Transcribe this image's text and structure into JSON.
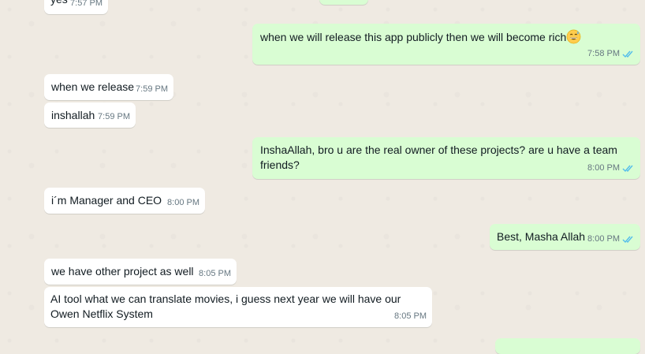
{
  "messages": [
    {
      "text": "yes",
      "time": "7:57 PM"
    },
    {
      "text": "when we will release this app publicly then we will become rich",
      "emoji": "grinning-sweat-face-emoji",
      "time": "7:58 PM",
      "status": "read"
    },
    {
      "text": "when we release",
      "time": "7:59 PM"
    },
    {
      "text": "inshallah",
      "time": "7:59 PM"
    },
    {
      "text": "InshaAllah, bro u are the real  owner of these projects? are u have a team friends?",
      "time": "8:00 PM",
      "status": "read"
    },
    {
      "text": "i´m Manager and  CEO",
      "time": "8:00 PM"
    },
    {
      "text": "Best, Masha Allah",
      "time": "8:00 PM",
      "status": "read"
    },
    {
      "text": "we have other project as well",
      "time": "8:05 PM"
    },
    {
      "text": "AI tool what we can translate movies, i guess next year we will have our Owen Netflix System",
      "time": "8:05 PM"
    }
  ],
  "colors": {
    "background": "#efeae2",
    "incoming": "#ffffff",
    "outgoing": "#d9fdd3",
    "read_ticks": "#53bdeb",
    "meta": "#667781"
  }
}
